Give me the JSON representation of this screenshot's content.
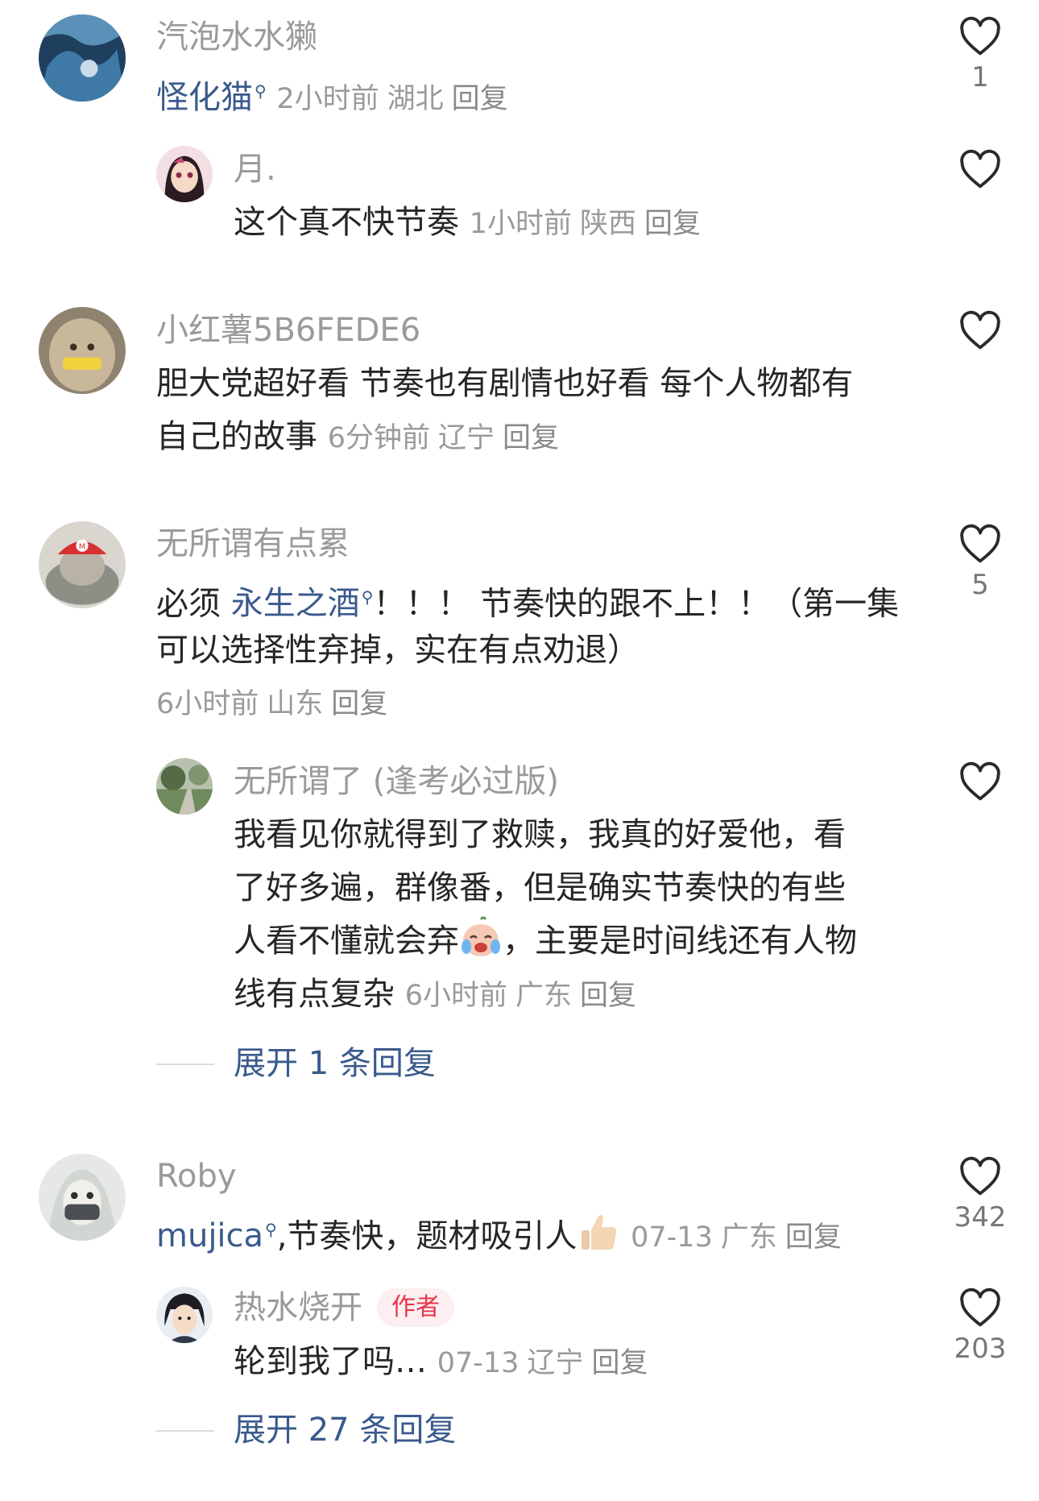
{
  "comments": [
    {
      "username": "汽泡水水獭",
      "mention": "怪化猫",
      "time": "2小时前",
      "location": "湖北",
      "reply": "回复",
      "likes": "1",
      "reply_item": {
        "username": "月.",
        "text": "这个真不快节奏",
        "time": "1小时前",
        "location": "陕西",
        "reply": "回复"
      }
    },
    {
      "username": "小红薯5B6FEDE6",
      "text_line1": "胆大党超好看 节奏也有剧情也好看 每个人物都有",
      "text_line2": "自己的故事",
      "time": "6分钟前",
      "location": "辽宁",
      "reply": "回复"
    },
    {
      "username": "无所谓有点累",
      "text_prefix": "必须 ",
      "mention": "永生之酒",
      "text_rest1": "！！！ 节奏快的跟不上！！（第一集",
      "text_line2": "可以选择性弃掉，实在有点劝退）",
      "time": "6小时前",
      "location": "山东",
      "reply": "回复",
      "likes": "5",
      "reply_item": {
        "username": "无所谓了 (逢考必过版)",
        "text_line1": "我看见你就得到了救赎，我真的好爱他，看",
        "text_line2": "了好多遍，群像番，但是确实节奏快的有些",
        "text_line3a": "人看不懂就会弃",
        "text_line3b": "，主要是时间线还有人物",
        "text_line4": "线有点复杂",
        "time": "6小时前",
        "location": "广东",
        "reply": "回复"
      },
      "expand": "展开 1 条回复"
    },
    {
      "username": "Roby",
      "mention": "mujica",
      "text": ",节奏快，题材吸引人",
      "time": "07-13",
      "location": "广东",
      "reply": "回复",
      "likes": "342",
      "reply_item": {
        "username": "热水烧开",
        "badge": "作者",
        "text": "轮到我了吗…",
        "time": "07-13",
        "location": "辽宁",
        "reply": "回复",
        "likes": "203"
      },
      "expand": "展开 27 条回复"
    }
  ],
  "icons": {
    "like": "heart-outline-icon",
    "mention": "search-magnifier-icon",
    "emoji_cry": "crying-face-emoji",
    "emoji_thumb": "thumbs-up-emoji"
  },
  "colors": {
    "link": "#3a5a8c",
    "meta": "#9a9a9a",
    "badge": "#e8334a"
  }
}
